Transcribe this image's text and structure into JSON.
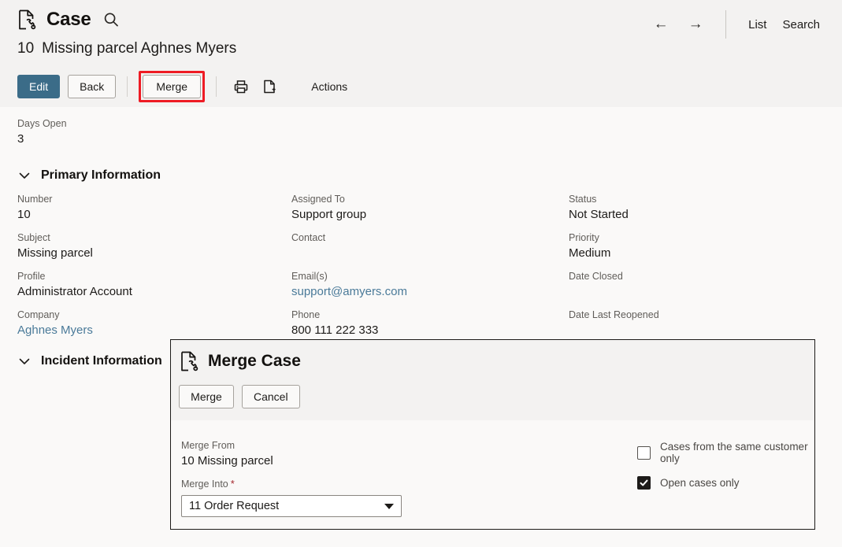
{
  "header": {
    "app_icon": "case-document-phone-icon",
    "title": "Case",
    "search_icon": "search-icon",
    "record_number": "10",
    "record_name": "Missing parcel Aghnes Myers",
    "nav": {
      "back_arrow": "←",
      "forward_arrow": "→",
      "list_label": "List",
      "search_label": "Search"
    }
  },
  "toolbar": {
    "edit_label": "Edit",
    "back_label": "Back",
    "merge_label": "Merge",
    "print_icon": "printer-icon",
    "new_doc_icon": "new-document-icon",
    "actions_label": "Actions",
    "highlight_color": "#ee1b24",
    "primary_color": "#3b6c88"
  },
  "body": {
    "days_open": {
      "label": "Days Open",
      "value": "3"
    },
    "sections": {
      "primary": {
        "title": "Primary Information",
        "chevron": "chevron-down-icon"
      },
      "incident": {
        "title": "Incident Information",
        "chevron": "chevron-down-icon"
      }
    },
    "column_1": [
      {
        "label": "Number",
        "value": "10",
        "link": false
      },
      {
        "label": "Subject",
        "value": "Missing parcel",
        "link": false
      },
      {
        "label": "Profile",
        "value": "Administrator Account",
        "link": false
      },
      {
        "label": "Company",
        "value": "Aghnes Myers",
        "link": true
      }
    ],
    "column_2": [
      {
        "label": "Assigned To",
        "value": "Support group",
        "link": false
      },
      {
        "label": "Contact",
        "value": "",
        "link": false
      },
      {
        "label": "Email(s)",
        "value": "support@amyers.com",
        "link": true
      },
      {
        "label": "Phone",
        "value": "800 111 222 333",
        "link": false
      }
    ],
    "column_3": [
      {
        "label": "Status",
        "value": "Not Started",
        "link": false
      },
      {
        "label": "Priority",
        "value": "Medium",
        "link": false
      },
      {
        "label": "Date Closed",
        "value": "",
        "link": false
      },
      {
        "label": "Date Last Reopened",
        "value": "",
        "link": false
      }
    ]
  },
  "dialog": {
    "icon": "case-document-phone-icon",
    "title": "Merge Case",
    "merge_label": "Merge",
    "cancel_label": "Cancel",
    "merge_from_label": "Merge From",
    "merge_from_value": "10 Missing parcel",
    "merge_into_label": "Merge Into",
    "merge_into_required": "*",
    "merge_into_value": "11 Order Request",
    "checkbox_same_customer": {
      "label": "Cases from the same customer only",
      "checked": false
    },
    "checkbox_open_only": {
      "label": "Open cases only",
      "checked": true
    }
  }
}
